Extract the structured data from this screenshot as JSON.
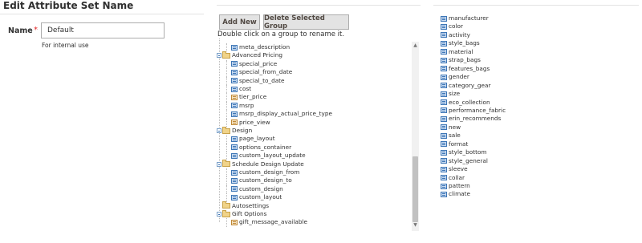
{
  "left": {
    "title": "Edit Attribute Set Name",
    "name_label": "Name",
    "required_marker": "*",
    "name_value": "Default",
    "note": "For internal use"
  },
  "groups": {
    "add_button": "Add New",
    "delete_button": "Delete Selected Group",
    "hint": "Double click on a group to rename it.",
    "tree": [
      {
        "type": "leaf",
        "label": "meta_description",
        "level": 1,
        "alt": false
      },
      {
        "type": "group",
        "label": "Advanced Pricing",
        "level": 0
      },
      {
        "type": "leaf",
        "label": "special_price",
        "level": 1,
        "alt": false
      },
      {
        "type": "leaf",
        "label": "special_from_date",
        "level": 1,
        "alt": false
      },
      {
        "type": "leaf",
        "label": "special_to_date",
        "level": 1,
        "alt": false
      },
      {
        "type": "leaf",
        "label": "cost",
        "level": 1,
        "alt": false
      },
      {
        "type": "leaf",
        "label": "tier_price",
        "level": 1,
        "alt": true
      },
      {
        "type": "leaf",
        "label": "msrp",
        "level": 1,
        "alt": false
      },
      {
        "type": "leaf",
        "label": "msrp_display_actual_price_type",
        "level": 1,
        "alt": false
      },
      {
        "type": "leaf",
        "label": "price_view",
        "level": 1,
        "alt": true
      },
      {
        "type": "group",
        "label": "Design",
        "level": 0
      },
      {
        "type": "leaf",
        "label": "page_layout",
        "level": 1,
        "alt": false
      },
      {
        "type": "leaf",
        "label": "options_container",
        "level": 1,
        "alt": false
      },
      {
        "type": "leaf",
        "label": "custom_layout_update",
        "level": 1,
        "alt": false
      },
      {
        "type": "group",
        "label": "Schedule Design Update",
        "level": 0
      },
      {
        "type": "leaf",
        "label": "custom_design_from",
        "level": 1,
        "alt": false
      },
      {
        "type": "leaf",
        "label": "custom_design_to",
        "level": 1,
        "alt": false
      },
      {
        "type": "leaf",
        "label": "custom_design",
        "level": 1,
        "alt": false
      },
      {
        "type": "leaf",
        "label": "custom_layout",
        "level": 1,
        "alt": false
      },
      {
        "type": "group",
        "label": "Autosettings",
        "level": 0,
        "noexpand": true
      },
      {
        "type": "group",
        "label": "Gift Options",
        "level": 0
      },
      {
        "type": "leaf",
        "label": "gift_message_available",
        "level": 1,
        "alt": true
      }
    ]
  },
  "unassigned": [
    "manufacturer",
    "color",
    "activity",
    "style_bags",
    "material",
    "strap_bags",
    "features_bags",
    "gender",
    "category_gear",
    "size",
    "eco_collection",
    "performance_fabric",
    "erin_recommends",
    "new",
    "sale",
    "format",
    "style_bottom",
    "style_general",
    "sleeve",
    "collar",
    "pattern",
    "climate"
  ]
}
